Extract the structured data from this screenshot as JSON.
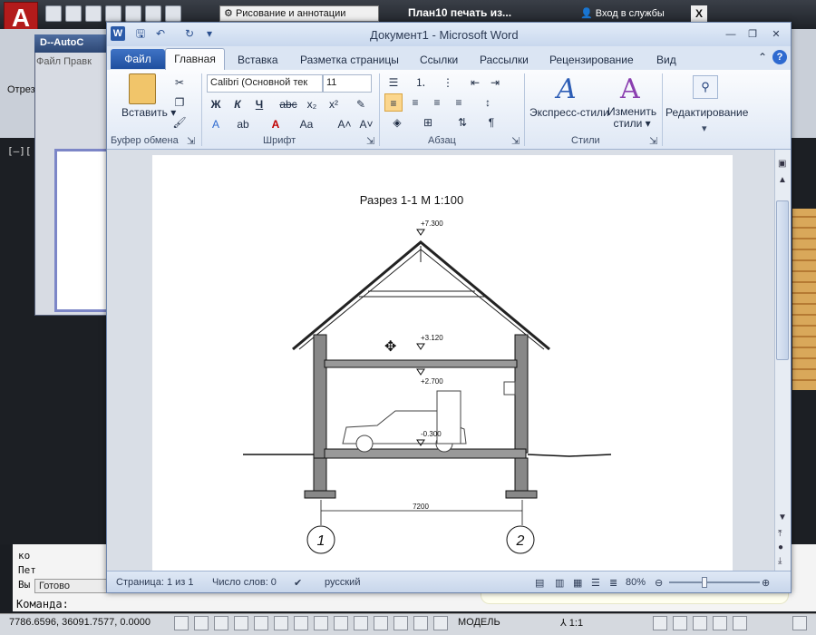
{
  "autocad": {
    "workspace": "Рисование и аннотации",
    "title": "План10 печать из...",
    "login": "Вход в службы",
    "logo_letter": "A",
    "subwin_title": "D--AutoC",
    "subwin_menu": [
      "Файл",
      "Правк"
    ],
    "trim_label": "Отрез",
    "viewport_label": "[–][",
    "cmd_lines": [
      "ко",
      "Пет",
      "Вы"
    ],
    "ready": "Готово",
    "prompt": "Команда:",
    "coords": "7786.6596, 36091.7577, 0.0000",
    "model": "МОДЕЛЬ",
    "scale": "1:1"
  },
  "word": {
    "title": "Документ1  -  Microsoft Word",
    "app_letter": "W",
    "tabs": {
      "file": "Файл",
      "home": "Главная",
      "insert": "Вставка",
      "layout": "Разметка страницы",
      "refs": "Ссылки",
      "mailings": "Рассылки",
      "review": "Рецензирование",
      "view": "Вид"
    },
    "ribbon": {
      "paste": "Вставить",
      "font_name": "Calibri (Основной тек",
      "font_size": "11",
      "express_styles": "Экспресс-стили",
      "change_styles_1": "Изменить",
      "change_styles_2": "стили",
      "editing": "Редактирование",
      "groups": {
        "clipboard": "Буфер обмена",
        "font": "Шрифт",
        "paragraph": "Абзац",
        "styles": "Стили"
      }
    },
    "status": {
      "page": "Страница: 1 из 1",
      "words": "Число слов: 0",
      "language": "русский",
      "zoom": "80%"
    }
  },
  "drawing": {
    "title": "Разрез 1-1 М 1:100",
    "levels": [
      "+7.300",
      "+3.120",
      "+2.700",
      "-0.300"
    ],
    "dimension": "7200",
    "axes": [
      "1",
      "2"
    ]
  },
  "colors": {
    "word_file_tab": "#1f4f9f",
    "acad_red": "#b31b1b"
  }
}
